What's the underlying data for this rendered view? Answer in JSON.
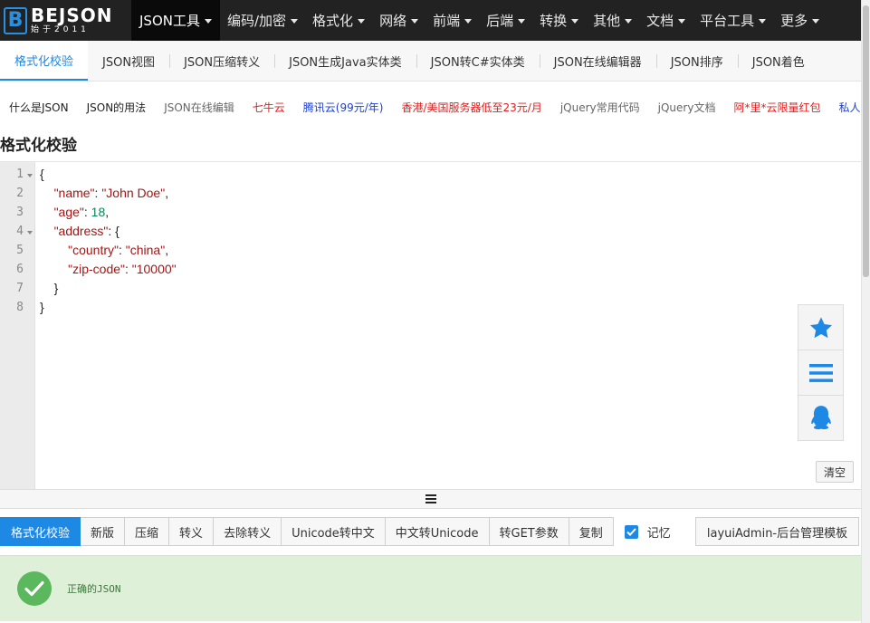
{
  "header": {
    "logo_letter": "B",
    "logo_name": "BEJSON",
    "logo_sub": "始于2011",
    "nav": [
      {
        "label": "JSON工具",
        "active": true
      },
      {
        "label": "编码/加密"
      },
      {
        "label": "格式化"
      },
      {
        "label": "网络"
      },
      {
        "label": "前端"
      },
      {
        "label": "后端"
      },
      {
        "label": "转换"
      },
      {
        "label": "其他"
      },
      {
        "label": "文档"
      },
      {
        "label": "平台工具"
      },
      {
        "label": "更多"
      }
    ]
  },
  "tabs": [
    {
      "label": "格式化校验",
      "active": true
    },
    {
      "label": "JSON视图"
    },
    {
      "label": "JSON压缩转义"
    },
    {
      "label": "JSON生成Java实体类"
    },
    {
      "label": "JSON转C#实体类"
    },
    {
      "label": "JSON在线编辑器"
    },
    {
      "label": "JSON排序"
    },
    {
      "label": "JSON着色"
    }
  ],
  "links": [
    {
      "label": "什么是JSON",
      "color": "#222222"
    },
    {
      "label": "JSON的用法",
      "color": "#222222"
    },
    {
      "label": "JSON在线编辑",
      "color": "#666666"
    },
    {
      "label": "七牛云",
      "color": "#e02020"
    },
    {
      "label": "腾讯云(99元/年)",
      "color": "#1a3fd6"
    },
    {
      "label": "香港/美国服务器低至23元/月",
      "color": "#e02020"
    },
    {
      "label": "jQuery常用代码",
      "color": "#666666"
    },
    {
      "label": "jQuery文档",
      "color": "#666666"
    },
    {
      "label": "阿*里*云限量红包",
      "color": "#e02020"
    },
    {
      "label": "私人",
      "color": "#1a3fd6"
    }
  ],
  "page_title": "格式化校验",
  "editor": {
    "line_numbers": [
      "1",
      "2",
      "3",
      "4",
      "5",
      "6",
      "7",
      "8"
    ],
    "code": {
      "l1": "{",
      "l2_key": "\"name\"",
      "l2_sep": ": ",
      "l2_val": "\"John Doe\"",
      "l2_end": ",",
      "l3_key": "\"age\"",
      "l3_sep": ": ",
      "l3_val": "18",
      "l3_end": ",",
      "l4_key": "\"address\"",
      "l4_sep": ": {",
      "l5_key": "\"country\"",
      "l5_sep": ": ",
      "l5_val": "\"china\"",
      "l5_end": ",",
      "l6_key": "\"zip-code\"",
      "l6_sep": ": ",
      "l6_val": "\"10000\"",
      "l7": "}",
      "l8": "}"
    },
    "clear_label": "清空"
  },
  "float_icons": [
    "star-icon",
    "menu-icon",
    "qq-icon"
  ],
  "actions": [
    {
      "label": "格式化校验",
      "primary": true
    },
    {
      "label": "新版"
    },
    {
      "label": "压缩"
    },
    {
      "label": "转义"
    },
    {
      "label": "去除转义"
    },
    {
      "label": "Unicode转中文"
    },
    {
      "label": "中文转Unicode"
    },
    {
      "label": "转GET参数"
    },
    {
      "label": "复制"
    }
  ],
  "remember_label": "记忆",
  "remember_checked": true,
  "admin_button": "layuiAdmin-后台管理模板",
  "status": {
    "text": "正确的JSON"
  },
  "colors": {
    "accent": "#1e88e5",
    "nav_bg": "#222222",
    "success": "#5cb85c",
    "success_bg": "#dff0d8"
  }
}
